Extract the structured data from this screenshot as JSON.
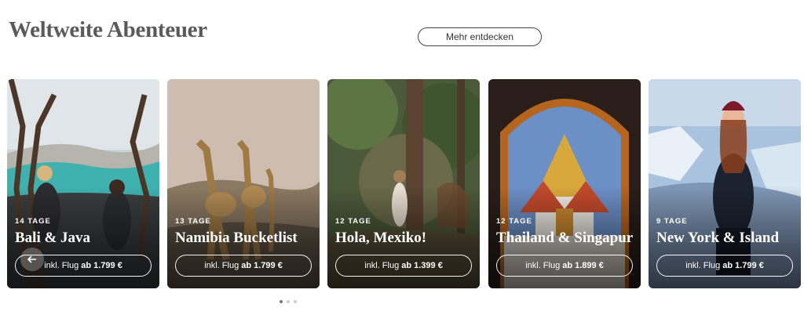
{
  "section": {
    "title": "Weltweite Abenteuer",
    "more_label": "Mehr entdecken"
  },
  "cards": [
    {
      "days": "14 TAGE",
      "name": "Bali & Java",
      "price_prefix": "inkl. Flug",
      "price": "ab 1.799 €"
    },
    {
      "days": "13 TAGE",
      "name": "Namibia Bucketlist",
      "price_prefix": "inkl. Flug",
      "price": "ab 1.799 €"
    },
    {
      "days": "12 TAGE",
      "name": "Hola, Mexiko!",
      "price_prefix": "inkl. Flug",
      "price": "ab 1.399 €"
    },
    {
      "days": "12 TAGE",
      "name": "Thailand & Singapur",
      "price_prefix": "inkl. Flug",
      "price": "ab 1.899 €"
    },
    {
      "days": "9 TAGE",
      "name": "New York & Island",
      "price_prefix": "inkl. Flug",
      "price": "ab 1.799 €"
    }
  ],
  "carousel": {
    "pages": 3,
    "active_page": 1
  }
}
